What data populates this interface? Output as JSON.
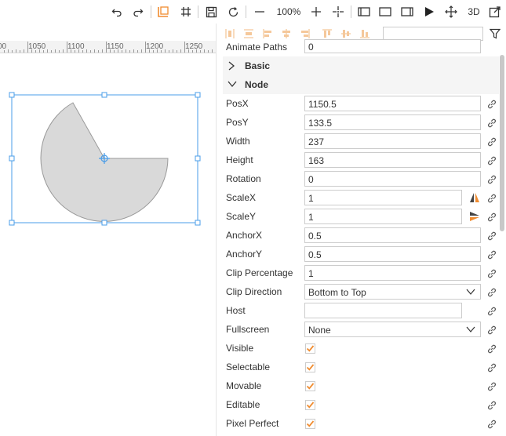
{
  "toolbar": {
    "zoom": "100%",
    "mode_3d": "3D",
    "colors": {
      "accent": "#f08c30"
    }
  },
  "ruler": {
    "labels": [
      "00",
      "1050",
      "1100",
      "1150",
      "1200",
      "1250"
    ]
  },
  "panel": {
    "top_row": {
      "label": "Animate Paths",
      "value": "0"
    },
    "sections": {
      "basic": "Basic",
      "node": "Node"
    },
    "fields": [
      {
        "label": "PosX",
        "value": "1150.5"
      },
      {
        "label": "PosY",
        "value": "133.5"
      },
      {
        "label": "Width",
        "value": "237"
      },
      {
        "label": "Height",
        "value": "163"
      },
      {
        "label": "Rotation",
        "value": "0"
      },
      {
        "label": "ScaleX",
        "value": "1"
      },
      {
        "label": "ScaleY",
        "value": "1"
      },
      {
        "label": "AnchorX",
        "value": "0.5"
      },
      {
        "label": "AnchorY",
        "value": "0.5"
      },
      {
        "label": "Clip Percentage",
        "value": "1"
      },
      {
        "label": "Clip Direction",
        "value": "Bottom to Top"
      },
      {
        "label": "Host",
        "value": ""
      },
      {
        "label": "Fullscreen",
        "value": "None"
      }
    ],
    "checks": [
      {
        "label": "Visible",
        "checked": true
      },
      {
        "label": "Selectable",
        "checked": true
      },
      {
        "label": "Movable",
        "checked": true
      },
      {
        "label": "Editable",
        "checked": true
      },
      {
        "label": "Pixel Perfect",
        "checked": true
      }
    ]
  },
  "canvas": {
    "shape_fill": "#d9d9d9",
    "selection_color": "#4a9de8"
  }
}
